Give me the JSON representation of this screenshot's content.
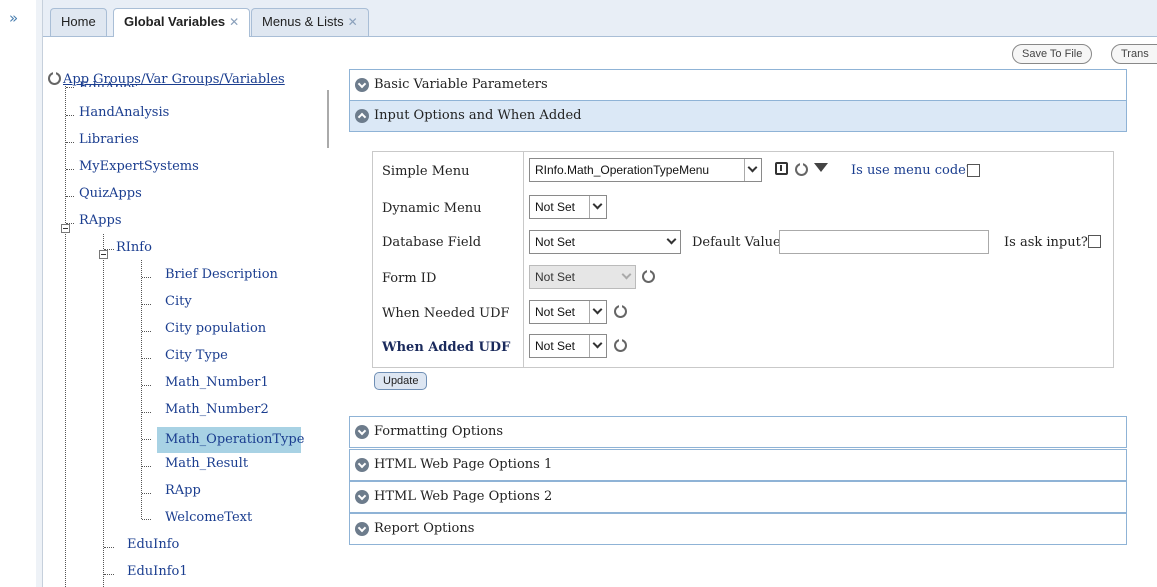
{
  "tabs": [
    {
      "label": "Home",
      "closable": false,
      "active": false
    },
    {
      "label": "Global Variables",
      "closable": true,
      "active": true
    },
    {
      "label": "Menus & Lists",
      "closable": true,
      "active": false
    }
  ],
  "toolbar": {
    "save_to_file": "Save To File",
    "trans": "Trans"
  },
  "tree": {
    "root": "App Groups/Var Groups/Variables",
    "items": [
      {
        "label": "EduApps"
      },
      {
        "label": "HandAnalysis"
      },
      {
        "label": "Libraries"
      },
      {
        "label": "MyExpertSystems"
      },
      {
        "label": "QuizApps"
      },
      {
        "label": "RApps"
      },
      {
        "label": "RInfo"
      },
      {
        "label": "Brief Description"
      },
      {
        "label": "City"
      },
      {
        "label": "City population"
      },
      {
        "label": "City Type"
      },
      {
        "label": "Math_Number1"
      },
      {
        "label": "Math_Number2"
      },
      {
        "label": "Math_OperationType",
        "selected": true
      },
      {
        "label": "Math_Result"
      },
      {
        "label": "RApp"
      },
      {
        "label": "WelcomeText"
      },
      {
        "label": "EduInfo"
      },
      {
        "label": "EduInfo1"
      }
    ]
  },
  "panels": {
    "basic": "Basic Variable Parameters",
    "input": "Input Options and When Added",
    "formatting": "Formatting Options",
    "html1": "HTML Web Page Options 1",
    "html2": "HTML Web Page Options 2",
    "report": "Report Options"
  },
  "form": {
    "simple_menu": {
      "label": "Simple Menu",
      "value": "RInfo.Math_OperationTypeMenu"
    },
    "is_use_menu_code": {
      "label": "Is use menu code?",
      "checked": false
    },
    "dynamic_menu": {
      "label": "Dynamic Menu",
      "value": "Not Set"
    },
    "database_field": {
      "label": "Database Field",
      "value": "Not Set"
    },
    "default_value": {
      "label": "Default Value:",
      "value": ""
    },
    "is_ask_input": {
      "label": "Is ask input?",
      "checked": false
    },
    "form_id": {
      "label": "Form ID",
      "value": "Not Set"
    },
    "when_needed_udf": {
      "label": "When Needed UDF",
      "value": "Not Set"
    },
    "when_added_udf": {
      "label": "When Added UDF",
      "value": "Not Set"
    },
    "update": "Update"
  }
}
